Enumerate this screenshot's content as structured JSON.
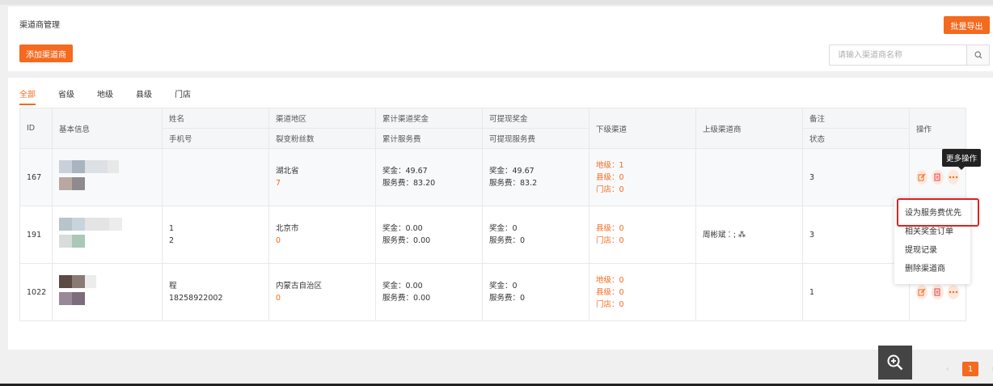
{
  "header": {
    "title": "渠道商管理",
    "export_label": "批量导出",
    "add_label": "添加渠道商"
  },
  "search": {
    "placeholder": "请输入渠道商名称",
    "icon": "search-icon"
  },
  "tabs": [
    {
      "label": "全部",
      "active": true
    },
    {
      "label": "省级"
    },
    {
      "label": "地级"
    },
    {
      "label": "县级"
    },
    {
      "label": "门店"
    }
  ],
  "table": {
    "headers": {
      "id": "ID",
      "info": "基本信息",
      "name": "姓名",
      "phone": "手机号",
      "region": "渠道地区",
      "fans": "裂变粉丝数",
      "reward_total": "累计渠道奖金",
      "fee_total": "累计服务费",
      "reward_avail": "可提现奖金",
      "fee_avail": "可提现服务费",
      "lower": "下级渠道",
      "upper": "上级渠道商",
      "remark": "备注",
      "status": "状态",
      "ops": "操作"
    },
    "rows": [
      {
        "id": "167",
        "name": "",
        "phone": "",
        "region": "湖北省",
        "fans": "7",
        "reward": "奖金：49.67",
        "fee": "服务费：83.20",
        "reward_avail": "奖金：49.67",
        "fee_avail": "服务费：83.2",
        "lower": [
          "地级：1",
          "县级：0",
          "门店：0"
        ],
        "upper": "",
        "status": "3"
      },
      {
        "id": "191",
        "name": "1",
        "phone": "2",
        "region": "北京市",
        "fans": "0",
        "reward": "奖金：0.00",
        "fee": "服务费：0.00",
        "reward_avail": "奖金：0",
        "fee_avail": "服务费：0",
        "lower": [
          "县级：0",
          "门店：0"
        ],
        "upper": "周彬斌 ⁚ ⁏ ⁂",
        "status": "3"
      },
      {
        "id": "1022",
        "name": "程",
        "phone": "18258922002",
        "region": "内蒙古自治区",
        "fans": "0",
        "reward": "奖金：0.00",
        "fee": "服务费：0.00",
        "reward_avail": "奖金：0",
        "fee_avail": "服务费：0",
        "lower": [
          "地级：0",
          "县级：0",
          "门店：0"
        ],
        "upper": "",
        "status": "1"
      }
    ]
  },
  "tooltip": "更多操作",
  "menu": [
    "设为服务费优先",
    "相关奖金订单",
    "提现记录",
    "删除渠道商"
  ],
  "pagination": {
    "prev": "‹",
    "current": "1",
    "next": "›"
  },
  "colors": {
    "accent": "#f46a1f",
    "highlight": "#e02020"
  }
}
